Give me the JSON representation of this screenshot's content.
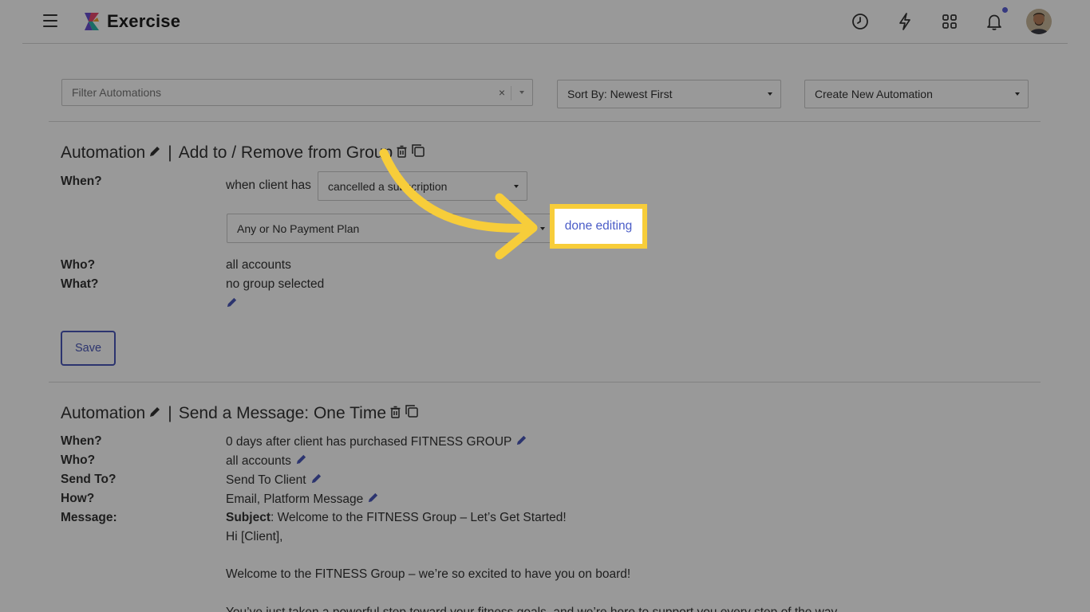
{
  "header": {
    "app_name": "Exercise",
    "icons": [
      "menu-icon",
      "clock-icon",
      "lightning-icon",
      "grid-icon",
      "bell-icon"
    ]
  },
  "toolbar": {
    "filter_placeholder": "Filter Automations",
    "filter_clear": "×",
    "sort_label": "Sort By: Newest First",
    "create_label": "Create New Automation"
  },
  "automation1": {
    "title_prefix": "Automation",
    "title_sep": "|",
    "title": "Add to / Remove from Group",
    "when_label": "When?",
    "when_prefix": "when client has",
    "when_select": "cancelled a subscription",
    "plan_select": "Any or No Payment Plan",
    "done_editing": "done editing",
    "who_label": "Who?",
    "who_value": "all accounts",
    "what_label": "What?",
    "what_value": "no group selected",
    "save_label": "Save"
  },
  "automation2": {
    "title_prefix": "Automation",
    "title_sep": "|",
    "title": "Send a Message: One Time",
    "when_label": "When?",
    "when_value": "0 days after client has purchased FITNESS GROUP",
    "who_label": "Who?",
    "who_value": "all accounts",
    "sendto_label": "Send To?",
    "sendto_value": "Send To Client",
    "how_label": "How?",
    "how_value": "Email, Platform Message",
    "message_label": "Message:",
    "subject_label": "Subject",
    "subject_value": ": Welcome to the FITNESS Group – Let’s Get Started!",
    "greeting": "Hi [Client],",
    "body_line1": "Welcome to the FITNESS Group – we’re so excited to have you on board!",
    "body_line2": "You’ve just taken a powerful step toward your fitness goals, and we’re here to support you every step of the way."
  },
  "colors": {
    "accent": "#4a58b9",
    "link": "#4a5cc7",
    "highlight": "#f7cd3a",
    "notification": "#5b5fd6"
  }
}
